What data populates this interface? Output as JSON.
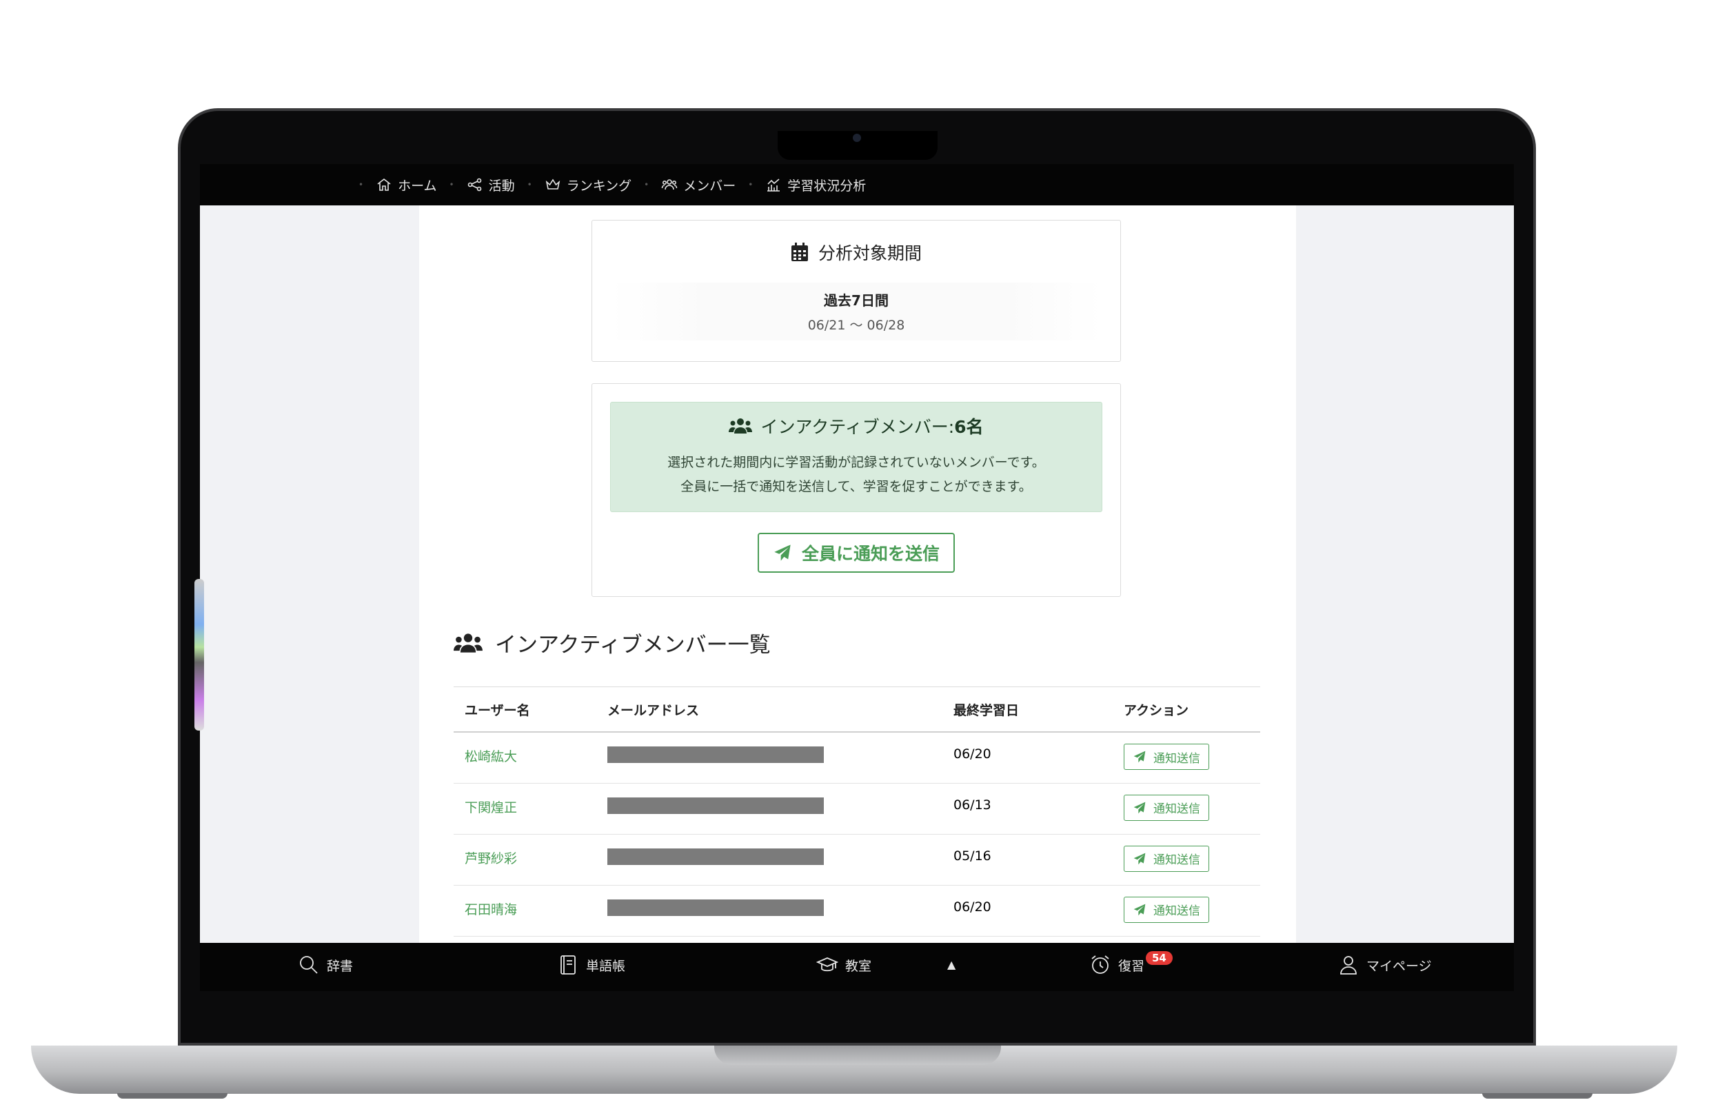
{
  "top_nav": {
    "items": [
      {
        "label": "ホーム",
        "icon": "home-icon"
      },
      {
        "label": "活動",
        "icon": "activity-icon"
      },
      {
        "label": "ランキング",
        "icon": "crown-icon"
      },
      {
        "label": "メンバー",
        "icon": "members-icon"
      },
      {
        "label": "学習状況分析",
        "icon": "chart-icon"
      }
    ]
  },
  "period": {
    "title": "分析対象期間",
    "label": "過去7日間",
    "range": "06/21 〜 06/28"
  },
  "inactive": {
    "title_prefix": "インアクティブメンバー: ",
    "count": "6名",
    "desc_line1": "選択された期間内に学習活動が記録されていないメンバーです。",
    "desc_line2": "全員に一括で通知を送信して、学習を促すことができます。",
    "notify_all_label": "全員に通知を送信"
  },
  "list": {
    "heading": "インアクティブメンバー一覧",
    "columns": [
      "ユーザー名",
      "メールアドレス",
      "最終学習日",
      "アクション"
    ],
    "rows": [
      {
        "name": "松崎紘大",
        "last": "06/20",
        "action": "通知送信"
      },
      {
        "name": "下関煌正",
        "last": "06/13",
        "action": "通知送信"
      },
      {
        "name": "芦野紗彩",
        "last": "05/16",
        "action": "通知送信"
      },
      {
        "name": "石田晴海",
        "last": "06/20",
        "action": "通知送信"
      }
    ]
  },
  "bottom_nav": {
    "items": [
      {
        "label": "辞書",
        "icon": "search-icon"
      },
      {
        "label": "単語帳",
        "icon": "notebook-icon"
      },
      {
        "label": "教室",
        "icon": "graduation-cap-icon"
      },
      {
        "label": "復習",
        "icon": "alarm-clock-icon",
        "badge": "54"
      },
      {
        "label": "マイページ",
        "icon": "user-icon"
      }
    ]
  },
  "colors": {
    "accent": "#4a9d56",
    "alert_bg": "#d9ecde",
    "badge": "#e53935"
  }
}
